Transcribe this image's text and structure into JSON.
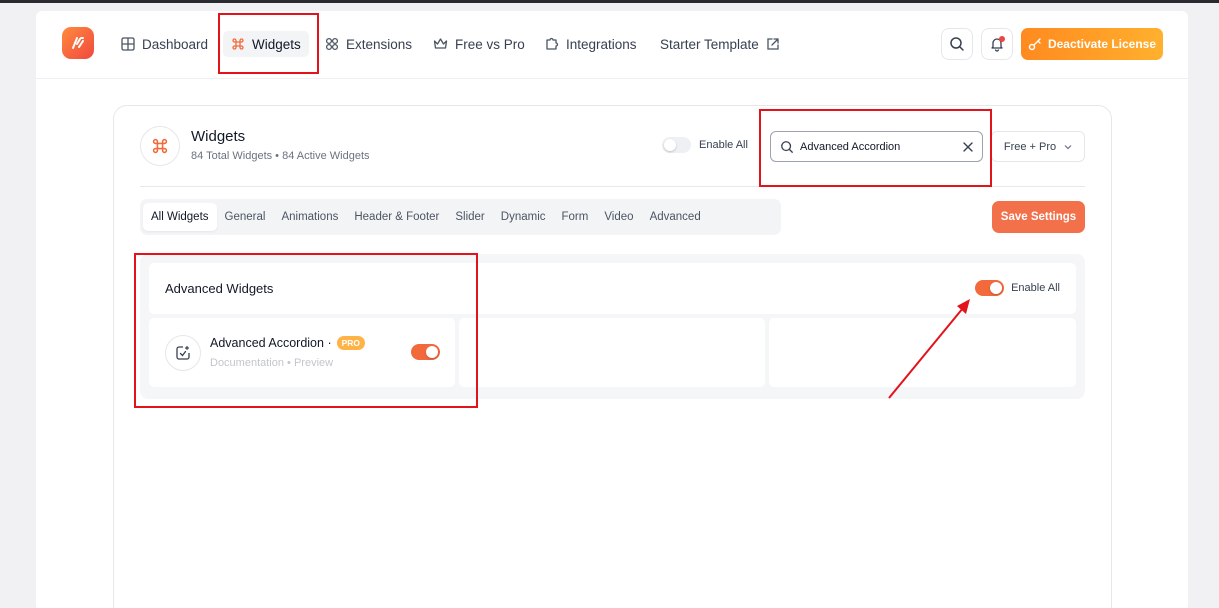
{
  "nav": {
    "items": [
      {
        "label": "Dashboard",
        "icon": "grid-icon"
      },
      {
        "label": "Widgets",
        "icon": "command-icon"
      },
      {
        "label": "Extensions",
        "icon": "extensions-icon"
      },
      {
        "label": "Free vs Pro",
        "icon": "crown-icon"
      },
      {
        "label": "Integrations",
        "icon": "puzzle-icon"
      },
      {
        "label": "Starter Template",
        "icon": "external-link-icon"
      }
    ],
    "deactivate_label": "Deactivate License"
  },
  "header": {
    "title": "Widgets",
    "subtitle": "84 Total Widgets • 84 Active Widgets",
    "enable_all_label": "Enable All",
    "search_value": "Advanced Accordion",
    "filter_value": "Free + Pro"
  },
  "tabs": [
    "All Widgets",
    "General",
    "Animations",
    "Header & Footer",
    "Slider",
    "Dynamic",
    "Form",
    "Video",
    "Advanced"
  ],
  "save_label": "Save Settings",
  "section": {
    "title": "Advanced Widgets",
    "enable_all_label": "Enable All",
    "enable_all_on": true,
    "widgets": [
      {
        "name": "Advanced Accordion ·",
        "badge": "PRO",
        "links": "Documentation • Preview",
        "enabled": true
      }
    ]
  },
  "colors": {
    "accent": "#f26a3b",
    "highlight": "#e3131b",
    "license_button": "#ff8a1f"
  }
}
